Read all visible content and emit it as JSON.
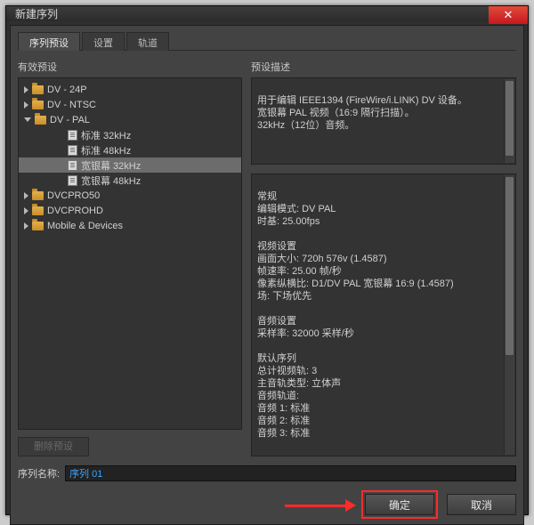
{
  "title": "新建序列",
  "tabs": [
    "序列预设",
    "设置",
    "轨道"
  ],
  "activeTab": 0,
  "leftPanel": {
    "title": "有效预设",
    "deleteBtn": "删除预设"
  },
  "tree": [
    {
      "type": "folder",
      "state": "closed",
      "indent": 0,
      "label": "DV - 24P"
    },
    {
      "type": "folder",
      "state": "closed",
      "indent": 0,
      "label": "DV - NTSC"
    },
    {
      "type": "folder",
      "state": "open",
      "indent": 0,
      "label": "DV - PAL"
    },
    {
      "type": "preset",
      "indent": 1,
      "label": "标准 32kHz"
    },
    {
      "type": "preset",
      "indent": 1,
      "label": "标准 48kHz"
    },
    {
      "type": "preset",
      "indent": 1,
      "label": "宽银幕 32kHz",
      "selected": true
    },
    {
      "type": "preset",
      "indent": 1,
      "label": "宽银幕 48kHz"
    },
    {
      "type": "folder",
      "state": "closed",
      "indent": 0,
      "label": "DVCPRO50"
    },
    {
      "type": "folder",
      "state": "closed",
      "indent": 0,
      "label": "DVCPROHD"
    },
    {
      "type": "folder",
      "state": "closed",
      "indent": 0,
      "label": "Mobile & Devices"
    }
  ],
  "rightPanel": {
    "title": "预设描述",
    "description": "用于编辑 IEEE1394 (FireWire/i.LINK) DV 设备。\n宽银幕 PAL 视频（16:9 隔行扫描）。\n32kHz（12位）音频。",
    "spec": "常规\n编辑模式: DV PAL\n时基: 25.00fps\n\n视频设置\n画面大小: 720h 576v (1.4587)\n帧速率: 25.00 帧/秒\n像素纵横比: D1/DV PAL 宽银幕 16:9 (1.4587)\n场: 下场优先\n\n音频设置\n采样率: 32000 采样/秒\n\n默认序列\n总计视频轨: 3\n主音轨类型: 立体声\n音频轨道:\n音频 1: 标准\n音频 2: 标准\n音频 3: 标准"
  },
  "sequence": {
    "label": "序列名称:",
    "value": "序列 01"
  },
  "buttons": {
    "ok": "确定",
    "cancel": "取消"
  }
}
